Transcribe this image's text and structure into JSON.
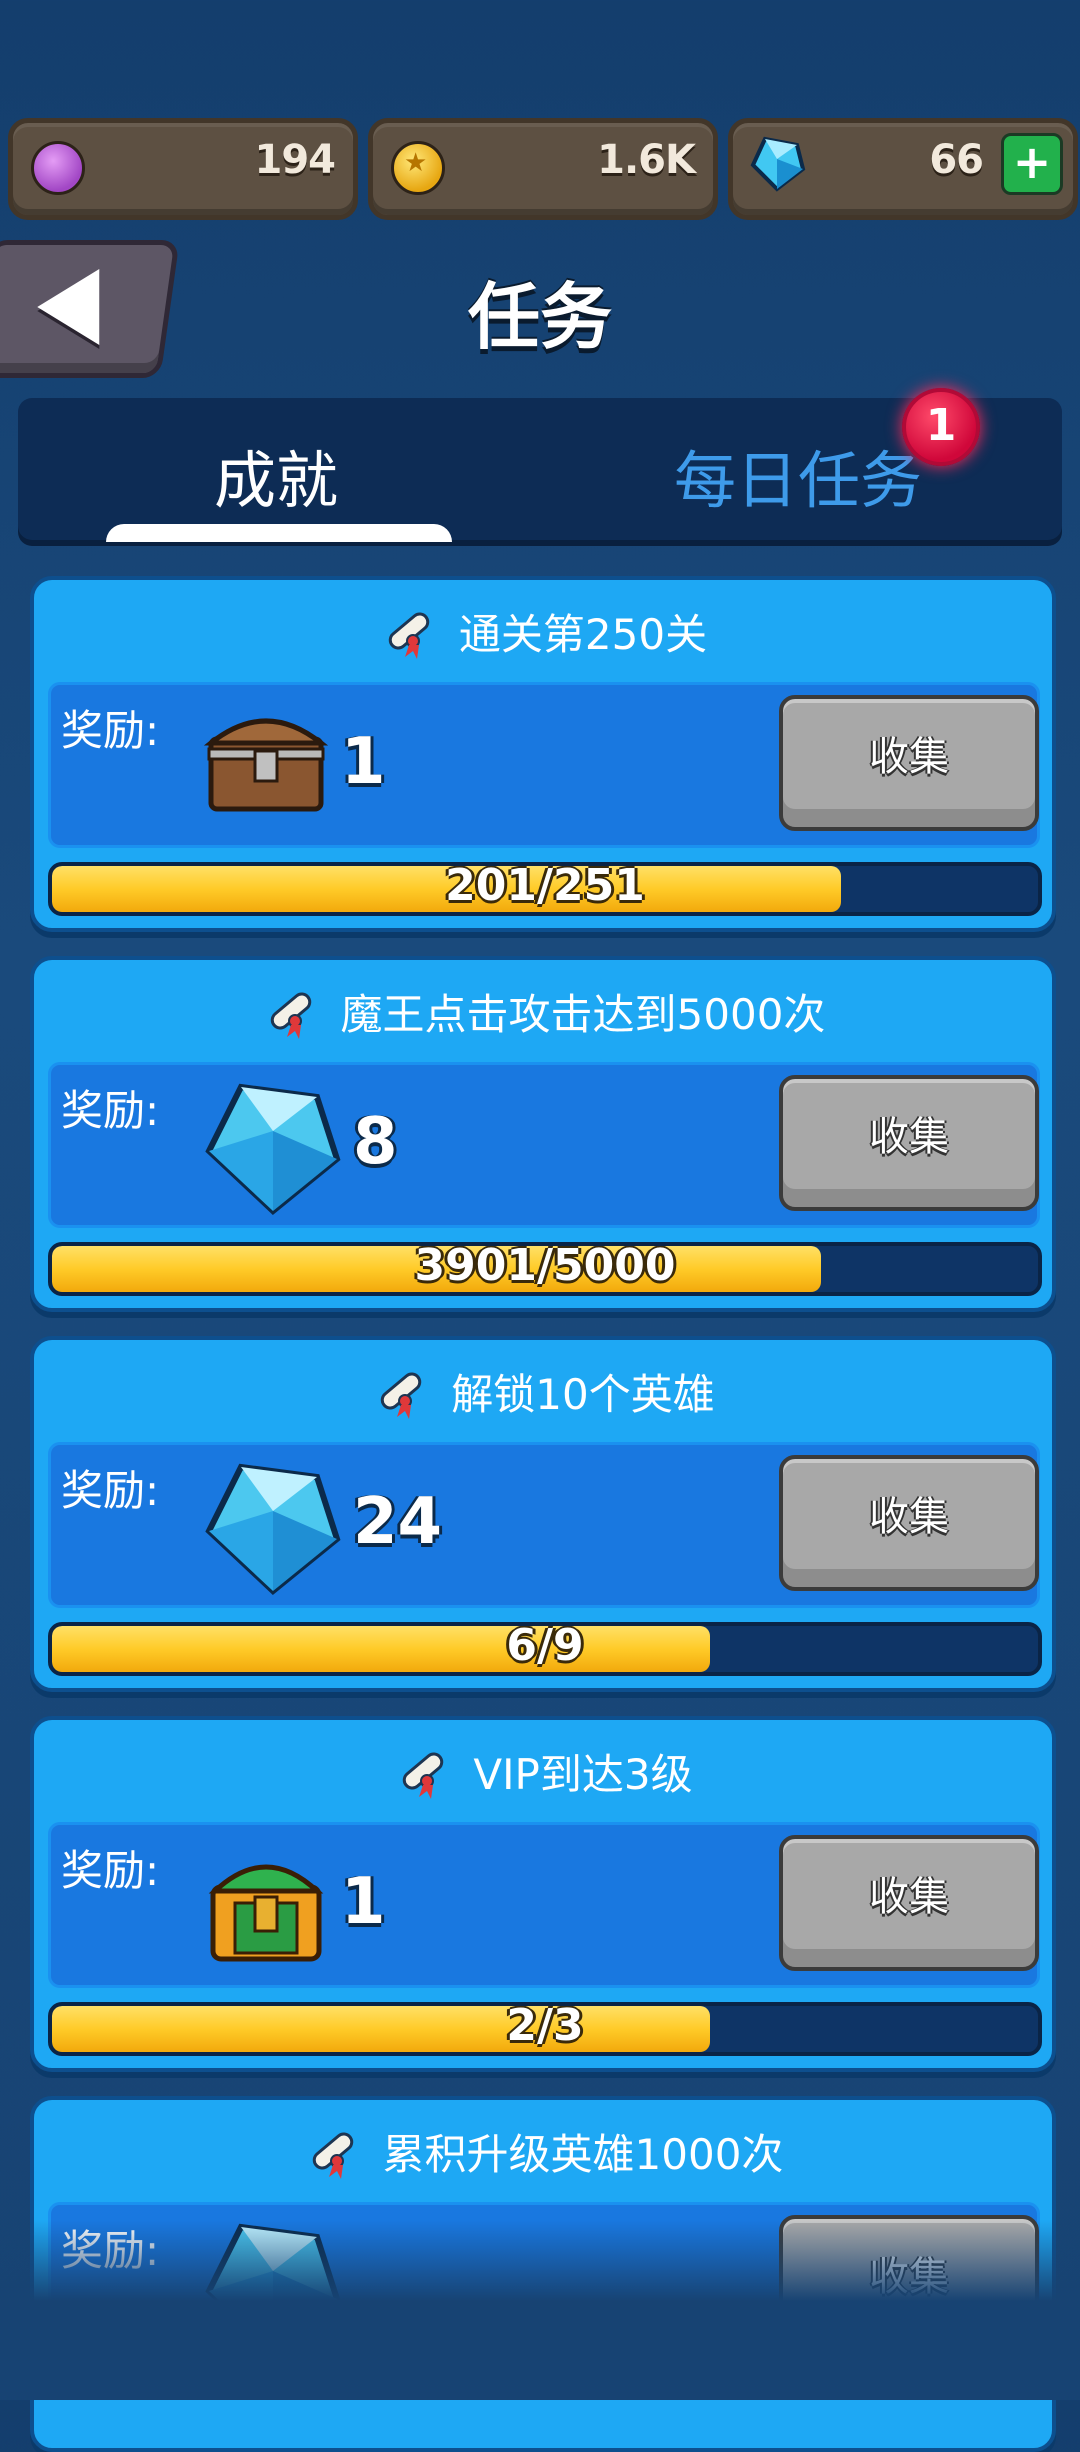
{
  "currencies": [
    {
      "name": "purple-coin",
      "value": "194"
    },
    {
      "name": "gold-coin",
      "value": "1.6K"
    },
    {
      "name": "gem",
      "value": "66"
    }
  ],
  "header": {
    "title": "任务"
  },
  "tabs": {
    "achievements": "成就",
    "daily": "每日任务",
    "daily_badge": "1"
  },
  "reward_label": "奖励:",
  "collect_label": "收集",
  "achievements": [
    {
      "title": "通关第250关",
      "reward_icon": "chest-icon",
      "reward_count": "1",
      "progress_text": "201/251",
      "progress": 0.8
    },
    {
      "title": "魔王点击攻击达到5000次",
      "reward_icon": "gem-icon",
      "reward_count": "8",
      "progress_text": "3901/5000",
      "progress": 0.78
    },
    {
      "title": "解锁10个英雄",
      "reward_icon": "gem-icon",
      "reward_count": "24",
      "progress_text": "6/9",
      "progress": 0.667
    },
    {
      "title": "VIP到达3级",
      "reward_icon": "green-chest-icon",
      "reward_count": "1",
      "progress_text": "2/3",
      "progress": 0.667
    },
    {
      "title": "累积升级英雄1000次",
      "reward_icon": "gem-icon"
    }
  ],
  "colors": {
    "card": "#1ea8f4",
    "reward_box": "#1978e0",
    "progress_fill": "#ffcb28",
    "badge": "#d0073a"
  }
}
